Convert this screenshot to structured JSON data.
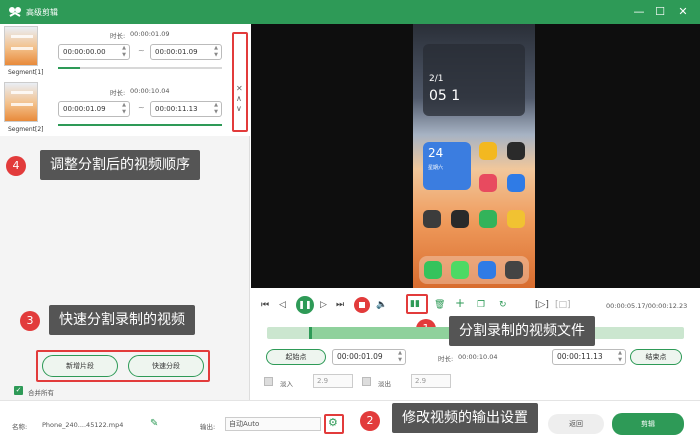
{
  "window": {
    "title": "高级剪辑",
    "minimize": "—",
    "maximize": "☐",
    "close": "✕"
  },
  "segments": [
    {
      "label": "Segment[1]",
      "duration_label": "时长:",
      "duration": "00:00:01.09",
      "start": "00:00:00.00",
      "end": "00:00:01.09"
    },
    {
      "label": "Segment[2]",
      "duration_label": "时长:",
      "duration": "00:00:10.04",
      "start": "00:00:01.09",
      "end": "00:00:11.13"
    }
  ],
  "reorder": {
    "close": "✕",
    "up": "∧",
    "down": "∨"
  },
  "callouts": {
    "c1": {
      "num": "1",
      "text": "分割录制的视频文件"
    },
    "c2": {
      "num": "2",
      "text": "修改视频的输出设置"
    },
    "c3": {
      "num": "3",
      "text": "快速分割录制的视频"
    },
    "c4": {
      "num": "4",
      "text": "调整分割后的视频顺序"
    }
  },
  "left_actions": {
    "new_segment": "新增片段",
    "quick_split": "快速分段"
  },
  "merge_all": {
    "label": "合并所有",
    "checked": true
  },
  "phone": {
    "date": "2/1",
    "time": "05 1",
    "widget_day": "24",
    "widget_sub": "星期六"
  },
  "player": {
    "time": "00:00:05.17/00:00:12.23"
  },
  "trim": {
    "start_btn": "起始点",
    "start_val": "00:00:01.09",
    "duration_label": "时长:",
    "duration_val": "00:00:10.04",
    "end_val": "00:00:11.13",
    "end_btn": "结束点"
  },
  "fade": {
    "fade_in": "淡入",
    "fade_in_val": "2.9",
    "fade_out": "淡出",
    "fade_out_val": "2.9"
  },
  "bottom": {
    "name_label": "名称:",
    "file_name": "Phone_240....45122.mp4",
    "output_label": "输出:",
    "output_val": "自动Auto",
    "back_btn": "返回",
    "edit_btn": "剪辑"
  },
  "colors": {
    "accent": "#2e9a57",
    "callout_red": "#e23b3b",
    "callout_bg": "#555555"
  }
}
